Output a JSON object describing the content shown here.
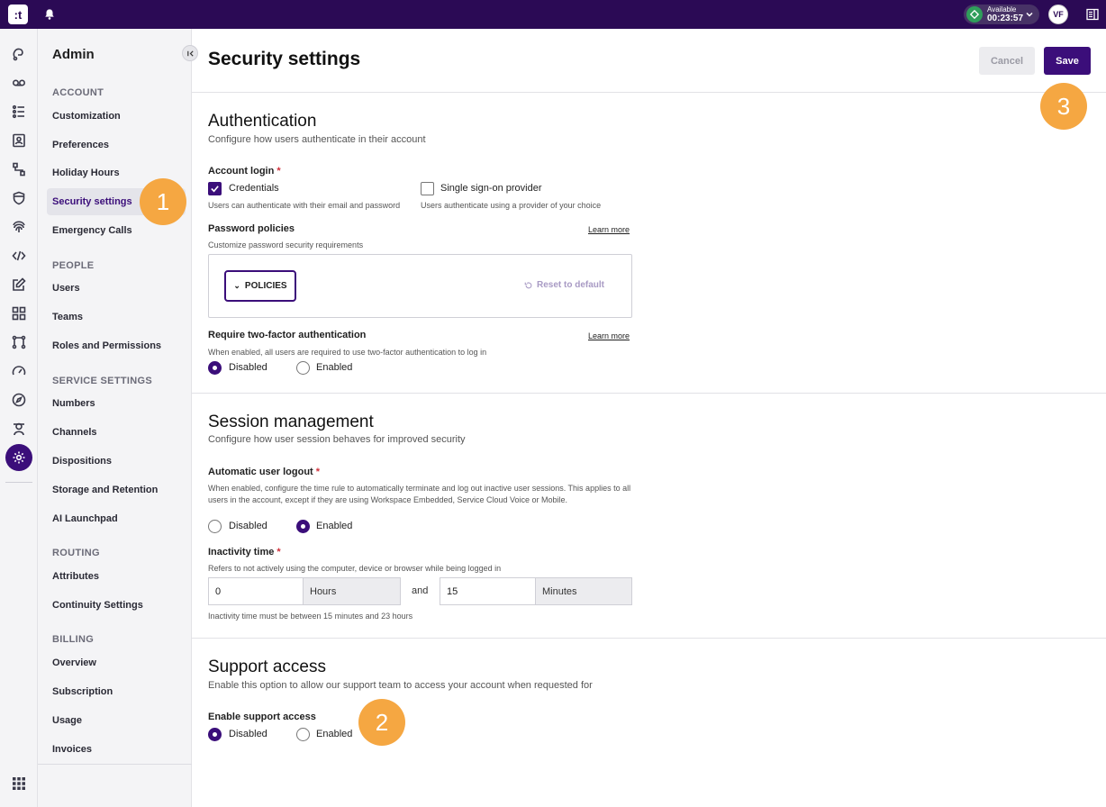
{
  "topbar": {
    "logo_text": ":t",
    "status_label": "Available",
    "status_timer": "00:23:57",
    "avatar_initials": "VF"
  },
  "rail": {
    "icons": [
      "inbox-icon",
      "voicemail-icon",
      "queue-list-icon",
      "contacts-icon",
      "flow-icon",
      "shield-icon",
      "fingerprint-icon",
      "code-icon",
      "edit-icon",
      "apps-icon",
      "routing-icon",
      "gauge-icon",
      "compass-icon",
      "agent-icon",
      "settings-gear-icon"
    ]
  },
  "sidebar": {
    "title": "Admin",
    "sections": [
      {
        "label": "ACCOUNT",
        "items": [
          "Customization",
          "Preferences",
          "Holiday Hours",
          "Security settings",
          "Emergency Calls"
        ]
      },
      {
        "label": "PEOPLE",
        "items": [
          "Users",
          "Teams",
          "Roles and Permissions"
        ]
      },
      {
        "label": "SERVICE SETTINGS",
        "items": [
          "Numbers",
          "Channels",
          "Dispositions",
          "Storage and Retention",
          "AI Launchpad"
        ]
      },
      {
        "label": "ROUTING",
        "items": [
          "Attributes",
          "Continuity Settings"
        ]
      },
      {
        "label": "BILLING",
        "items": [
          "Overview",
          "Subscription",
          "Usage",
          "Invoices"
        ]
      }
    ],
    "active_item": "Security settings"
  },
  "header": {
    "title": "Security settings",
    "cancel_label": "Cancel",
    "save_label": "Save"
  },
  "authentication": {
    "title": "Authentication",
    "description": "Configure how users authenticate in their account",
    "account_login": {
      "label": "Account login",
      "required_mark": "*",
      "options": [
        {
          "label": "Credentials",
          "help": "Users can authenticate with their email and password",
          "checked": true
        },
        {
          "label": "Single sign-on provider",
          "help": "Users authenticate using a provider of your choice",
          "checked": false
        }
      ]
    },
    "password_policies": {
      "label": "Password policies",
      "help": "Customize password security requirements",
      "learn_more": "Learn more",
      "policies_button": "POLICIES",
      "reset_label": "Reset to default"
    },
    "two_factor": {
      "label": "Require two-factor authentication",
      "help": "When enabled, all users are required to use two-factor authentication to log in",
      "learn_more": "Learn more",
      "options": [
        "Disabled",
        "Enabled"
      ],
      "selected": "Disabled"
    }
  },
  "session": {
    "title": "Session management",
    "description": "Configure how user session behaves for improved security",
    "auto_logout": {
      "label": "Automatic user logout",
      "required_mark": "*",
      "help": "When enabled, configure the time rule to automatically terminate and log out inactive user sessions. This applies to all users in the account, except if they are using Workspace Embedded, Service Cloud Voice or Mobile.",
      "options": [
        "Disabled",
        "Enabled"
      ],
      "selected": "Enabled"
    },
    "inactivity": {
      "label": "Inactivity time",
      "required_mark": "*",
      "help": "Refers to not actively using the computer, device or browser while being logged in",
      "hours_value": "0",
      "hours_unit": "Hours",
      "and_text": "and",
      "minutes_value": "15",
      "minutes_unit": "Minutes",
      "note": "Inactivity time must be between 15 minutes and 23 hours"
    }
  },
  "support": {
    "title": "Support access",
    "description": "Enable this option to allow our support team to access your account when requested for",
    "label": "Enable support access",
    "options": [
      "Disabled",
      "Enabled"
    ],
    "selected": "Disabled"
  },
  "annotations": {
    "badge_1": "1",
    "badge_2": "2",
    "badge_3": "3",
    "badge_color": "#f5a742"
  },
  "colors": {
    "brand": "#2b0a55",
    "accent": "#3b0e7a",
    "status_green": "#2f9e5b"
  }
}
